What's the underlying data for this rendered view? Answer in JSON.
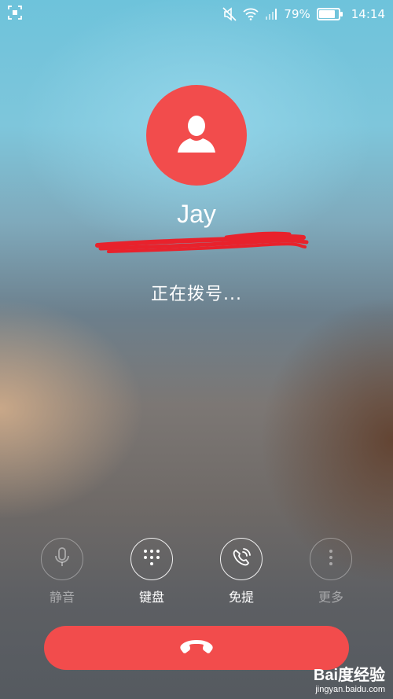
{
  "status_bar": {
    "battery_percent": "79%",
    "battery_level": 0.79,
    "time": "14:14",
    "icons": [
      "screenshot-icon",
      "mute-notification-icon",
      "wifi-icon",
      "signal-icon",
      "battery-icon"
    ]
  },
  "contact": {
    "name": "Jay",
    "avatar_icon": "person-icon",
    "avatar_color": "#f24c4c"
  },
  "call_status": "正在拨号...",
  "controls": [
    {
      "label": "静音",
      "icon": "microphone-icon",
      "enabled": false
    },
    {
      "label": "键盘",
      "icon": "dialpad-icon",
      "enabled": true
    },
    {
      "label": "免提",
      "icon": "speaker-phone-icon",
      "enabled": true
    },
    {
      "label": "更多",
      "icon": "more-vertical-icon",
      "enabled": false
    }
  ],
  "end_call": {
    "icon": "hang-up-icon",
    "color": "#f24c4c"
  },
  "watermark": {
    "brand": "Bai度经验",
    "url": "jingyan.baidu.com"
  }
}
